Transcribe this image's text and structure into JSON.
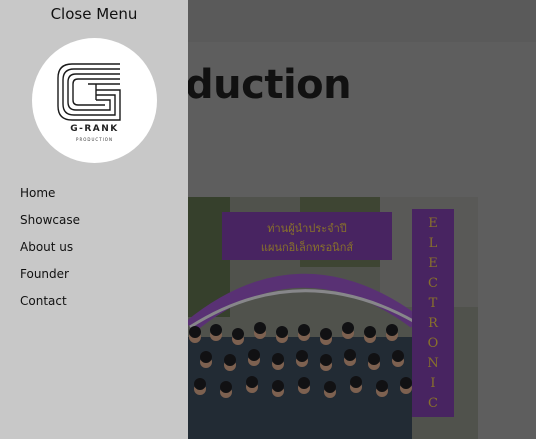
{
  "header": {
    "partial_title": "on"
  },
  "page": {
    "heading": "Production"
  },
  "menu": {
    "close_label": "Close Menu",
    "logo": {
      "name": "G-RANK",
      "sub": "PRODUCTION"
    },
    "items": [
      {
        "label": "Home"
      },
      {
        "label": "Showcase"
      },
      {
        "label": "About us"
      },
      {
        "label": "Founder"
      },
      {
        "label": "Contact"
      }
    ]
  },
  "photo": {
    "banner_text": "ท่านผู้นำประจำปี แผนกอิเล็กทรอนิกส์",
    "vertical_banner_text": "ELECTRONIC",
    "colors": {
      "banner": "#7c3fa8",
      "uniform": "#3c4a5a",
      "overlay": "rgba(0,0,0,0.5)"
    }
  }
}
